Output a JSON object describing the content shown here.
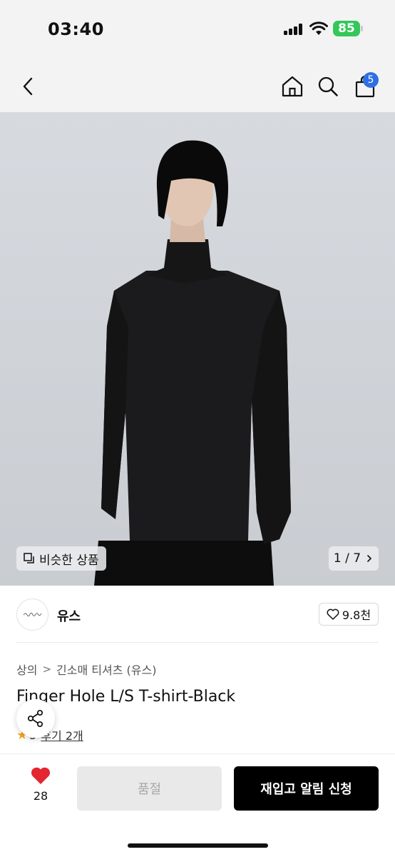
{
  "status_bar": {
    "time": "03:40",
    "battery": "85"
  },
  "nav": {
    "cart_count": "5"
  },
  "hero": {
    "similar_label": "비슷한 상품",
    "counter": "1 / 7"
  },
  "brand": {
    "name": "유스",
    "likes": "9.8천"
  },
  "breadcrumb": {
    "category": "상의",
    "subcategory": "긴소매 티셔츠 (유스)"
  },
  "product": {
    "title": "Finger Hole L/S T-shirt-Black",
    "rating": "5",
    "reviews": "후기 2개"
  },
  "bottom": {
    "wish_count": "28",
    "soldout_label": "품절",
    "restock_label": "재입고 알림 신청"
  },
  "colors": {
    "badge": "#2f6fe4",
    "battery": "#34c759",
    "heart": "#e3262f",
    "star": "#f5a623"
  }
}
